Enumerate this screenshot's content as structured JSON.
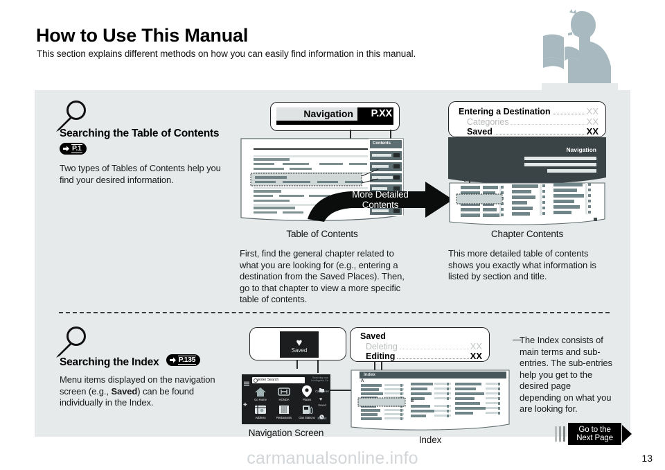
{
  "page": {
    "title": "How to Use This Manual",
    "subtitle": "This section explains different methods on how you can easily find information in this manual.",
    "number": "13",
    "watermark": "carmanualsonline.info"
  },
  "reader_icon": "person-reading-book-icon",
  "section_toc": {
    "magnifier_icon": "magnifier-icon",
    "heading": "Searching the Table of Contents",
    "page_ref": "P.1",
    "body": "Two types of Tables of Contents help you find your desired information.",
    "nav_callout": {
      "label": "Navigation",
      "page": "P.XX"
    },
    "toc_illustration": {
      "tab_label": "Contents",
      "caption": "Table of Contents"
    },
    "swoosh_label": "More Detailed\nContents",
    "swoosh_label_line1": "More Detailed",
    "swoosh_label_line2": "Contents",
    "chapter_callout": {
      "rows": [
        {
          "label": "Entering a Destination",
          "page": "XX",
          "dim": false
        },
        {
          "label": "Categories",
          "page": "XX",
          "dim": true
        },
        {
          "label": "Saved",
          "page": "XX",
          "dim": false
        }
      ]
    },
    "chapter_illustration": {
      "header_label": "Navigation",
      "caption": "Chapter Contents"
    },
    "desc_left": "First, find the general chapter related to what you are looking for (e.g., entering a destination from the Saved Places). Then, go to that chapter to view a more specific table of contents.",
    "desc_right": "This more detailed table of contents shows you exactly what information is listed by section and title."
  },
  "section_index": {
    "magnifier_icon": "magnifier-icon",
    "heading": "Searching the Index",
    "page_ref": "P.135",
    "body_prefix": "Menu items displayed on the navigation screen (e.g., ",
    "body_bold": "Saved",
    "body_suffix": ") can be found individually in the Index.",
    "saved_tile": {
      "icon": "heart-icon",
      "label": "Saved"
    },
    "saved_callout": {
      "title": "Saved",
      "rows": [
        {
          "label": "Deleting",
          "page": "XX",
          "dim": true
        },
        {
          "label": "Editing",
          "page": "XX",
          "dim": false
        }
      ]
    },
    "nav_screen": {
      "caption": "Navigation Screen",
      "search_placeholder": "Enter Search",
      "search_icon": "search-icon",
      "menu_icon": "hamburger-menu-icon",
      "corner_line1": "Searching near",
      "corner_line2": "Los Angeles, CA",
      "tiles": [
        {
          "label": "Go Home",
          "icon": "home-icon"
        },
        {
          "label": "HONDA",
          "icon": "honda-logo-icon"
        },
        {
          "label": "Places",
          "icon": "map-pin-icon"
        },
        {
          "label": "Address",
          "icon": "address-icon"
        },
        {
          "label": "Restaurants",
          "icon": "restaurant-icon"
        },
        {
          "label": "Gas Stations",
          "icon": "gas-pump-icon"
        }
      ],
      "side_items": [
        {
          "label": "Categories",
          "icon": "categories-icon"
        },
        {
          "label": "Saved",
          "icon": "heart-icon"
        },
        {
          "label": "Recent",
          "icon": "clock-icon"
        }
      ]
    },
    "index_illustration": {
      "header_label": "Index",
      "letter_a": "A",
      "letter_b": "B",
      "caption": "Index"
    },
    "desc_right": "The Index consists of main terms and sub-entries. The sub-entries help you get to the desired page depending on what you are looking for."
  },
  "next_page_button": {
    "line1": "Go to the",
    "line2": "Next Page",
    "arrow_icon": "triangle-right-icon"
  },
  "colors": {
    "panel_bg": "#e6eaea",
    "ink": "#000000",
    "doc_ink": "#5c7679",
    "dark_header": "#3a4346",
    "dim": "#b9bcbd"
  }
}
